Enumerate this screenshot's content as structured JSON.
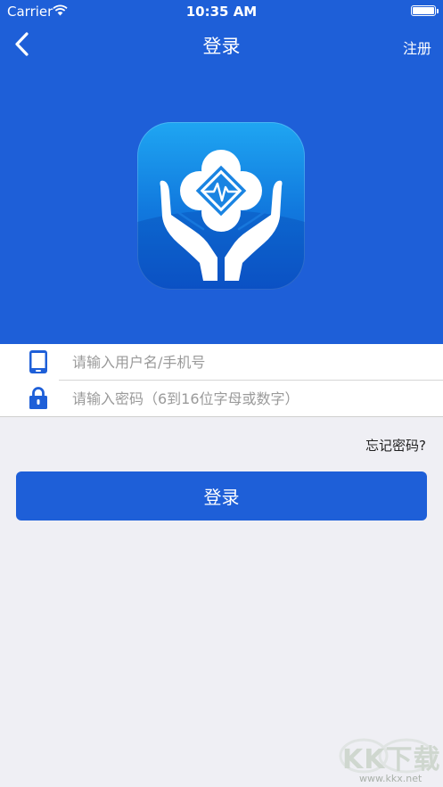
{
  "status_bar": {
    "carrier": "Carrier",
    "time": "10:35 AM"
  },
  "nav": {
    "title": "登录",
    "register_label": "注册"
  },
  "form": {
    "username_placeholder": "请输入用户名/手机号",
    "password_placeholder": "请输入密码（6到16位字母或数字）"
  },
  "forgot_password_label": "忘记密码?",
  "login_button_label": "登录",
  "watermark": {
    "text": "KK下载",
    "url": "www.kkx.net"
  },
  "colors": {
    "primary": "#1e5fd8",
    "background": "#efeff4",
    "logo_light": "#1fa6f2"
  },
  "icons": {
    "back": "chevron-left-icon",
    "wifi": "wifi-icon",
    "battery": "battery-icon",
    "phone": "phone-icon",
    "lock": "lock-icon"
  }
}
